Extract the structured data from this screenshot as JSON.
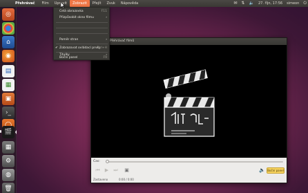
{
  "top_panel": {
    "app_name": "Přehrávač",
    "menus": [
      {
        "label": "Film"
      },
      {
        "label": "Upravit"
      },
      {
        "label": "Zobrazit"
      },
      {
        "label": "Přejít"
      },
      {
        "label": "Zvuk"
      },
      {
        "label": "Nápověda"
      }
    ],
    "clock": "27. říjn, 17:56",
    "user": "simeon"
  },
  "view_menu": {
    "items": [
      {
        "label": "Celá obrazovka",
        "shortcut": "F11",
        "disabled": false
      },
      {
        "label": "Přizpůsobit okno filmu",
        "disabled": false,
        "submenu": true
      },
      {
        "label": "Poměr stran",
        "disabled": false,
        "submenu": true
      },
      {
        "label": "Zobrazovat ovládací prvky",
        "shortcut": "Ctrl+H",
        "disabled": false,
        "checked": true
      },
      {
        "label": "Titulky",
        "disabled": false,
        "submenu": true
      },
      {
        "label": "Boční panel",
        "shortcut": "F9",
        "disabled": false
      }
    ]
  },
  "video_window": {
    "title": "Přehrávač filmů",
    "seek_label": "Čas:",
    "sidebar_button": "Boční panel",
    "status": "Zastaveno",
    "time": "0:00 / 0:00"
  },
  "colors": {
    "accent": "#f07746",
    "sidebar_button": "#f6d25f"
  }
}
